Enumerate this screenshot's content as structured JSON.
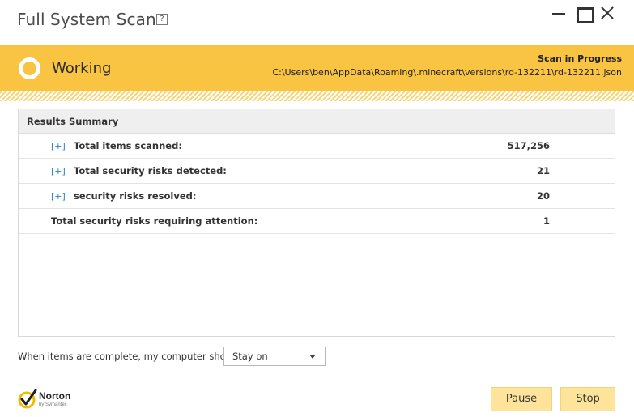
{
  "window": {
    "title": "Full System Scan",
    "help_label": "?"
  },
  "status": {
    "state": "Working",
    "heading": "Scan in Progress",
    "current_file": "C:\\Users\\ben\\AppData\\Roaming\\.minecraft\\versions\\rd-132211\\rd-132211.json",
    "accent_color": "#f9c442"
  },
  "results": {
    "header": "Results Summary",
    "rows": [
      {
        "expander": "[+]",
        "label": "Total items scanned:",
        "value": "517,256"
      },
      {
        "expander": "[+]",
        "label": "Total security risks detected:",
        "value": "21"
      },
      {
        "expander": "[+]",
        "label": "security risks resolved:",
        "value": "20"
      },
      {
        "expander": "",
        "label": "Total security risks requiring attention:",
        "value": "1"
      }
    ]
  },
  "completion": {
    "prompt": "When items are complete, my computer should",
    "selected_option": "Stay on"
  },
  "brand": {
    "name": "Norton",
    "sub": "by Symantec"
  },
  "buttons": {
    "pause": "Pause",
    "stop": "Stop"
  }
}
